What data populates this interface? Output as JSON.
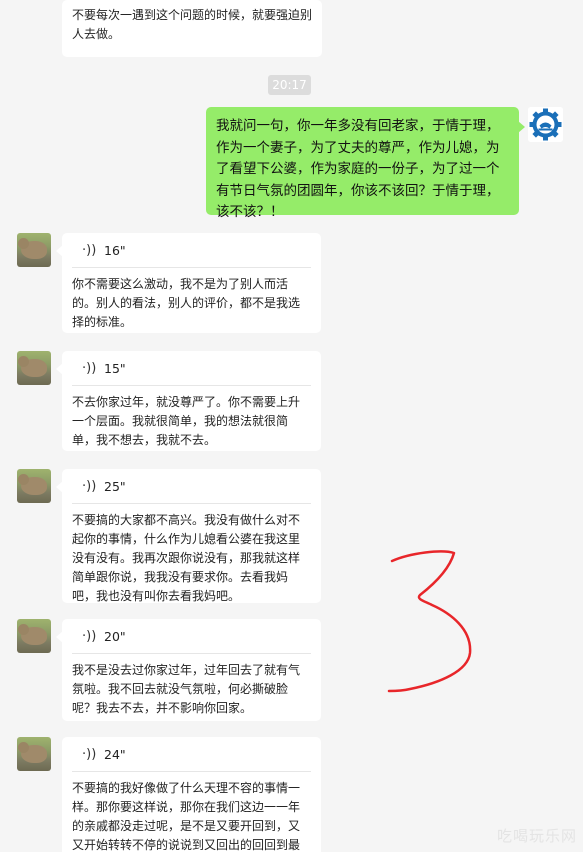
{
  "top_message": "不要每次一遇到这个问题的时候，就要强迫别人去做。",
  "timestamp": "20:17",
  "my_message": "我就问一句，你一年多没有回老家，于情于理，作为一个妻子，为了丈夫的尊严，作为儿媳，为了看望下公婆，作为家庭的一份子，为了过一个有节日气氛的团圆年，你该不该回？于情于理，该不该？！",
  "voice_messages": [
    {
      "duration": "16\"",
      "transcript": "你不需要这么激动，我不是为了别人而活的。别人的看法，别人的评价，都不是我选择的标准。"
    },
    {
      "duration": "15\"",
      "transcript": "不去你家过年，就没尊严了。你不需要上升一个层面。我就很简单，我的想法就很简单，我不想去，我就不去。"
    },
    {
      "duration": "25\"",
      "transcript": "不要搞的大家都不高兴。我没有做什么对不起你的事情，什么作为儿媳看公婆在我这里没有没有。我再次跟你说没有，那我就这样简单跟你说，我我没有要求你。去看我妈吧，我也没有叫你去看我妈吧。"
    },
    {
      "duration": "20\"",
      "transcript": "我不是没去过你家过年，过年回去了就有气氛啦。我不回去就没气氛啦，何必撕破脸呢？我去不去，并不影响你回家。"
    },
    {
      "duration": "24\"",
      "transcript": "不要搞的我好像做了什么天理不容的事情一样。那你要这样说，那你在我们这边一一年的亲戚都没走过呢，是不是又要开回到，又又开始转转不停的说说到又回出的回回到最初的纠"
    }
  ],
  "annotation_mark": "3",
  "watermark": "吃喝玩乐网",
  "colors": {
    "my_bubble": "#95ec69",
    "background": "#f5f5f5",
    "annotation": "#e8262a"
  },
  "icons": {
    "voice": "voice-wave-icon",
    "my_avatar": "gear-avatar-icon",
    "their_avatar": "bear-photo-avatar"
  }
}
